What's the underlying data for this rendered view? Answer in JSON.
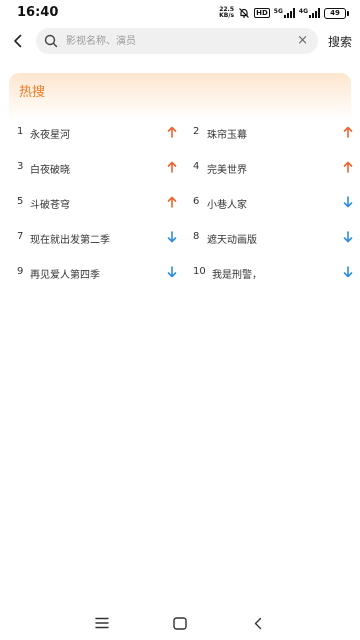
{
  "status_bar": {
    "time": "16:40",
    "net_speed_value": "22.5",
    "net_speed_unit": "KB/s",
    "hd_label": "HD",
    "sim1_label": "5G",
    "sim2_label": "4G",
    "battery_level": "49"
  },
  "search": {
    "placeholder": "影视名称、演员",
    "value": "",
    "clear_icon": "×",
    "button_label": "搜索"
  },
  "hot_search": {
    "title": "热搜",
    "items": [
      {
        "rank": "1",
        "name": "永夜星河",
        "trend": "up"
      },
      {
        "rank": "2",
        "name": "珠帘玉幕",
        "trend": "up"
      },
      {
        "rank": "3",
        "name": "白夜破晓",
        "trend": "up"
      },
      {
        "rank": "4",
        "name": "完美世界",
        "trend": "up"
      },
      {
        "rank": "5",
        "name": "斗破苍穹",
        "trend": "up"
      },
      {
        "rank": "6",
        "name": "小巷人家",
        "trend": "down"
      },
      {
        "rank": "7",
        "name": "现在就出发第二季",
        "trend": "down"
      },
      {
        "rank": "8",
        "name": "遮天动画版",
        "trend": "down"
      },
      {
        "rank": "9",
        "name": "再见爱人第四季",
        "trend": "down"
      },
      {
        "rank": "10",
        "name": "我是刑警，",
        "trend": "down"
      }
    ]
  },
  "colors": {
    "up": "#f0622a",
    "down": "#2b8de6",
    "accent": "#f07a22"
  },
  "nav_bar": {
    "icons": [
      "menu-icon",
      "home-icon",
      "back-icon"
    ]
  }
}
